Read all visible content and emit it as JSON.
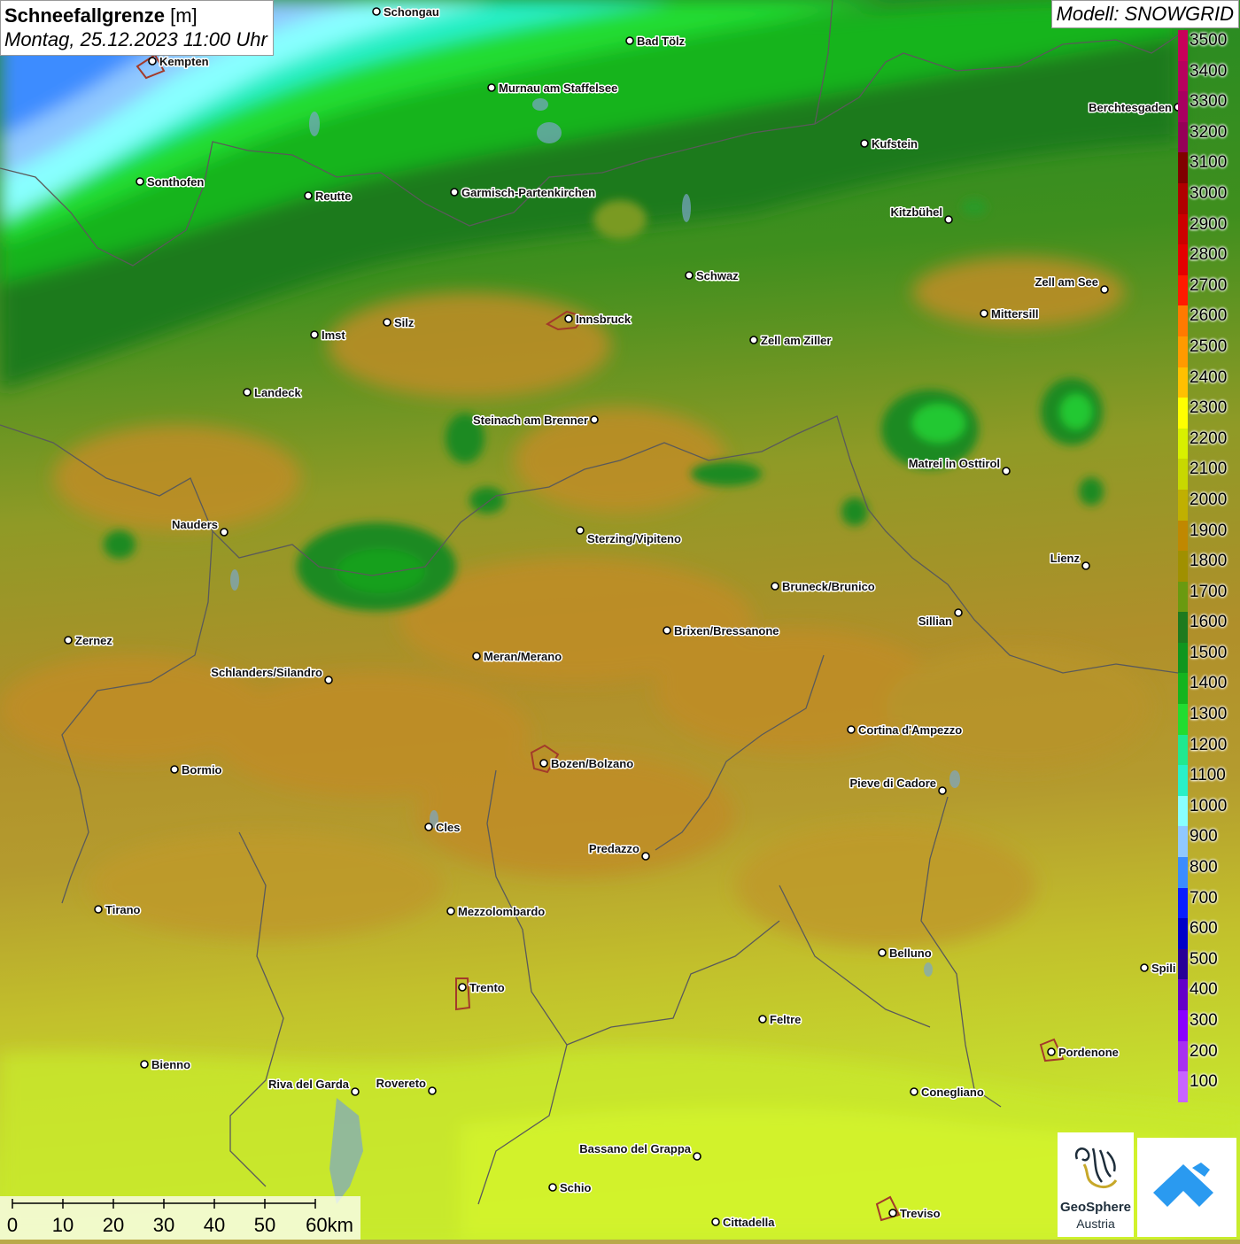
{
  "title": {
    "main_bold": "Schneefallgrenze",
    "main_unit": "[m]",
    "date": "Montag, 25.12.2023 11:00 Uhr"
  },
  "model_label": "Modell: SNOWGRID",
  "legend": [
    {
      "value": "3500",
      "color": "#c8005a"
    },
    {
      "value": "3400",
      "color": "#b8005e"
    },
    {
      "value": "3300",
      "color": "#a80060"
    },
    {
      "value": "3200",
      "color": "#960058"
    },
    {
      "value": "3100",
      "color": "#800000"
    },
    {
      "value": "3000",
      "color": "#b00000"
    },
    {
      "value": "2900",
      "color": "#cc0000"
    },
    {
      "value": "2800",
      "color": "#e40000"
    },
    {
      "value": "2700",
      "color": "#ff1a00"
    },
    {
      "value": "2600",
      "color": "#ff7a00"
    },
    {
      "value": "2500",
      "color": "#ff9a00"
    },
    {
      "value": "2400",
      "color": "#ffc000"
    },
    {
      "value": "2300",
      "color": "#ffff00"
    },
    {
      "value": "2200",
      "color": "#d8f000"
    },
    {
      "value": "2100",
      "color": "#c8d800"
    },
    {
      "value": "2000",
      "color": "#c0b000"
    },
    {
      "value": "1900",
      "color": "#c08800"
    },
    {
      "value": "1800",
      "color": "#a09000"
    },
    {
      "value": "1700",
      "color": "#6a9a10"
    },
    {
      "value": "1600",
      "color": "#1e7a1e"
    },
    {
      "value": "1500",
      "color": "#10961e"
    },
    {
      "value": "1400",
      "color": "#14b41e"
    },
    {
      "value": "1300",
      "color": "#22dc30"
    },
    {
      "value": "1200",
      "color": "#20e890"
    },
    {
      "value": "1100",
      "color": "#28f0c8"
    },
    {
      "value": "1000",
      "color": "#88ffff"
    },
    {
      "value": "900",
      "color": "#90c8ff"
    },
    {
      "value": "800",
      "color": "#3c8cff"
    },
    {
      "value": "700",
      "color": "#0a1eff"
    },
    {
      "value": "600",
      "color": "#0000c8"
    },
    {
      "value": "500",
      "color": "#280096"
    },
    {
      "value": "400",
      "color": "#6400c8"
    },
    {
      "value": "300",
      "color": "#8a00ff"
    },
    {
      "value": "200",
      "color": "#a830f0"
    },
    {
      "value": "100",
      "color": "#c864ff"
    }
  ],
  "cities": [
    {
      "name": "Schongau"
    },
    {
      "name": "Bad Tölz"
    },
    {
      "name": "Kempten"
    },
    {
      "name": "Murnau am Staffelsee"
    },
    {
      "name": "Berchtesgaden"
    },
    {
      "name": "Kufstein"
    },
    {
      "name": "Sonthofen"
    },
    {
      "name": "Reutte"
    },
    {
      "name": "Garmisch-Partenkirchen"
    },
    {
      "name": "Kitzbühel"
    },
    {
      "name": "Schwaz"
    },
    {
      "name": "Zell am See"
    },
    {
      "name": "Mittersill"
    },
    {
      "name": "Innsbruck"
    },
    {
      "name": "Silz"
    },
    {
      "name": "Imst"
    },
    {
      "name": "Zell am Ziller"
    },
    {
      "name": "Landeck"
    },
    {
      "name": "Steinach am Brenner"
    },
    {
      "name": "Matrei in Osttirol"
    },
    {
      "name": "Nauders"
    },
    {
      "name": "Sterzing/Vipiteno"
    },
    {
      "name": "Lienz"
    },
    {
      "name": "Bruneck/Brunico"
    },
    {
      "name": "Sillian"
    },
    {
      "name": "Brixen/Bressanone"
    },
    {
      "name": "Zernez"
    },
    {
      "name": "Meran/Merano"
    },
    {
      "name": "Schlanders/Silandro"
    },
    {
      "name": "Cortina d'Ampezzo"
    },
    {
      "name": "Bormio"
    },
    {
      "name": "Bozen/Bolzano"
    },
    {
      "name": "Pieve di Cadore"
    },
    {
      "name": "Cles"
    },
    {
      "name": "Predazzo"
    },
    {
      "name": "Tirano"
    },
    {
      "name": "Mezzolombardo"
    },
    {
      "name": "Belluno"
    },
    {
      "name": "Spili"
    },
    {
      "name": "Trento"
    },
    {
      "name": "Feltre"
    },
    {
      "name": "Pordenone"
    },
    {
      "name": "Bienno"
    },
    {
      "name": "Riva del Garda"
    },
    {
      "name": "Rovereto"
    },
    {
      "name": "Conegliano"
    },
    {
      "name": "Bassano del Grappa"
    },
    {
      "name": "Schio"
    },
    {
      "name": "Treviso"
    },
    {
      "name": "Cittadella"
    }
  ],
  "scale_bar": {
    "ticks": [
      "0",
      "10",
      "20",
      "30",
      "40",
      "50",
      "60km"
    ]
  },
  "logo": {
    "line1": "GeoSphere",
    "line2": "Austria"
  }
}
